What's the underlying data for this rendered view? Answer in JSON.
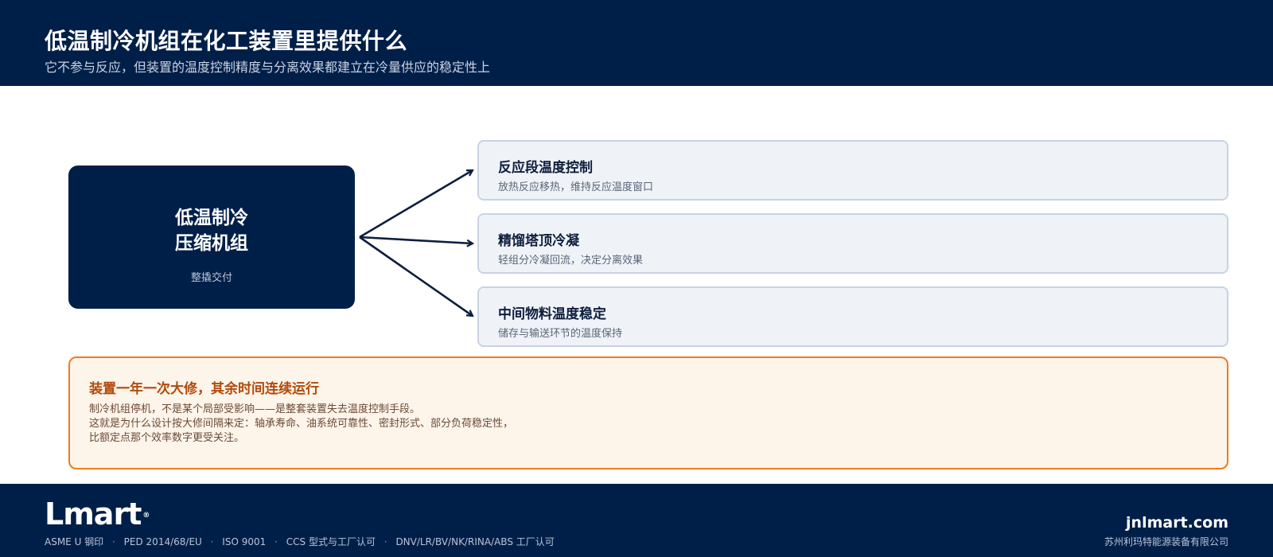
{
  "header": {
    "title": "低温制冷机组在化工装置里提供什么",
    "subtitle": "它不参与反应，但装置的温度控制精度与分离效果都建立在冷量供应的稳定性上"
  },
  "source": {
    "line1": "低温制冷",
    "line2": "压缩机组",
    "note": "整撬交付"
  },
  "targets": [
    {
      "title": "反应段温度控制",
      "desc": "放热反应移热，维持反应温度窗口"
    },
    {
      "title": "精馏塔顶冷凝",
      "desc": "轻组分冷凝回流，决定分离效果"
    },
    {
      "title": "中间物料温度稳定",
      "desc": "储存与输送环节的温度保持"
    }
  ],
  "notice": {
    "title": "装置一年一次大修，其余时间连续运行",
    "lines": [
      "制冷机组停机，不是某个局部受影响——是整套装置失去温度控制手段。",
      "这就是为什么设计按大修间隔来定：轴承寿命、油系统可靠性、密封形式、部分负荷稳定性，",
      "比额定点那个效率数字更受关注。"
    ]
  },
  "footer": {
    "logo_text": "Lmart",
    "logo_reg": "®",
    "certs": [
      "ASME U 钢印",
      "PED 2014/68/EU",
      "ISO 9001",
      "CCS 型式与工厂认可",
      "DNV/LR/BV/NK/RINA/ABS 工厂认可"
    ],
    "cert_separator": "·",
    "domain": "jnlmart.com",
    "company": "苏州利玛特能源装备有限公司"
  },
  "colors": {
    "navy": "#001f48",
    "card_bg": "#eff3f8",
    "card_border": "#c8d3e2",
    "notice_border": "#ee7c22",
    "notice_bg": "#fdf4ea",
    "notice_title": "#b14a0c"
  }
}
